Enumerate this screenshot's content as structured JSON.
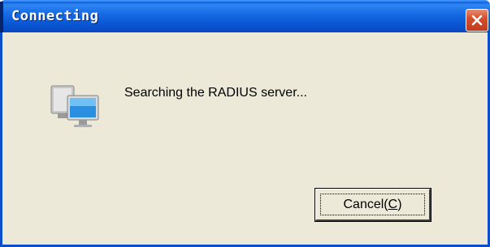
{
  "window": {
    "title": "Connecting",
    "colors": {
      "titlebar": "#0a58d6",
      "body": "#ece9d8",
      "close": "#d5502e"
    }
  },
  "dialog": {
    "icon": "network-computers-icon",
    "message": "Searching the RADIUS server...",
    "cancel_label": "Cancel(",
    "cancel_accel": "C",
    "cancel_suffix": ")"
  }
}
